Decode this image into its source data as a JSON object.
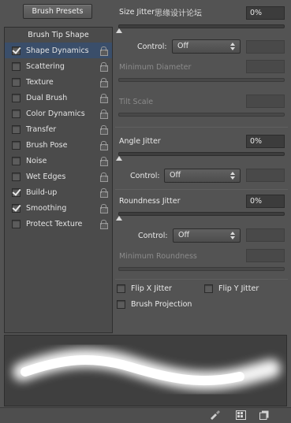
{
  "presets_button": "Brush Presets",
  "tip_shape_label": "Brush Tip Shape",
  "options": [
    {
      "label": "Shape Dynamics",
      "checked": true,
      "selected": true
    },
    {
      "label": "Scattering",
      "checked": false
    },
    {
      "label": "Texture",
      "checked": false
    },
    {
      "label": "Dual Brush",
      "checked": false
    },
    {
      "label": "Color Dynamics",
      "checked": false
    },
    {
      "label": "Transfer",
      "checked": false
    },
    {
      "label": "Brush Pose",
      "checked": false
    },
    {
      "label": "Noise",
      "checked": false
    },
    {
      "label": "Wet Edges",
      "checked": false
    },
    {
      "label": "Build-up",
      "checked": true
    },
    {
      "label": "Smoothing",
      "checked": true
    },
    {
      "label": "Protect Texture",
      "checked": false
    }
  ],
  "size_jitter": {
    "label": "Size Jitter",
    "value": "0%",
    "slider": 0
  },
  "watermark": "思缘设计论坛",
  "control_label": "Control:",
  "size_control": "Off",
  "min_diameter_label": "Minimum Diameter",
  "tilt_scale_label": "Tilt Scale",
  "angle_jitter": {
    "label": "Angle Jitter",
    "value": "0%",
    "slider": 0
  },
  "angle_control": "Off",
  "roundness_jitter": {
    "label": "Roundness Jitter",
    "value": "0%",
    "slider": 0
  },
  "roundness_control": "Off",
  "min_roundness_label": "Minimum Roundness",
  "flip_x": {
    "label": "Flip X Jitter",
    "checked": false
  },
  "flip_y": {
    "label": "Flip Y Jitter",
    "checked": false
  },
  "brush_projection": {
    "label": "Brush Projection",
    "checked": false
  },
  "icons": [
    "brush-tool-icon",
    "grid-icon",
    "new-preset-icon"
  ]
}
